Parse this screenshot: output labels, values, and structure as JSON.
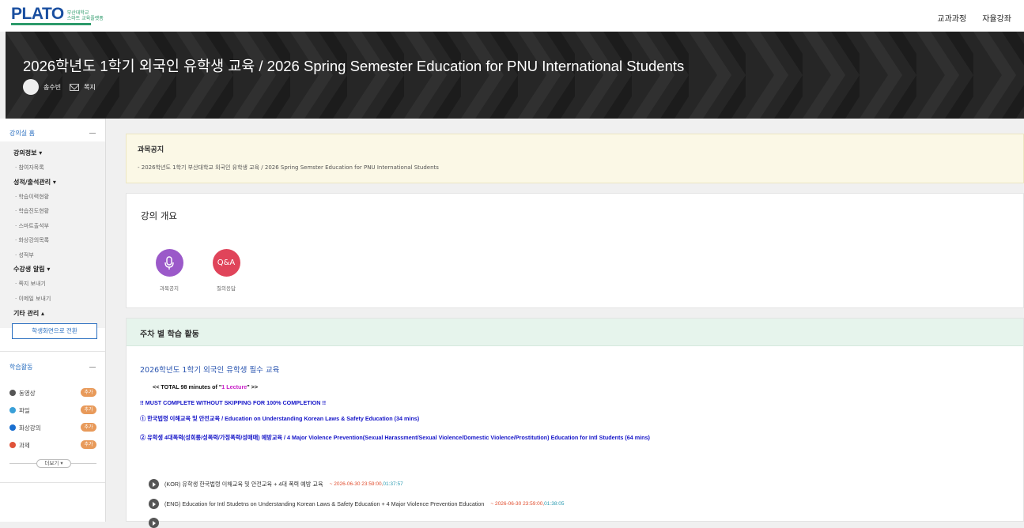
{
  "header": {
    "logo": "PLATO",
    "logo_sub1": "부산대학교",
    "logo_sub2": "스마트 교육플랫폼",
    "nav": [
      "교과과정",
      "자율강좌"
    ]
  },
  "banner": {
    "course_title": "2026학년도 1학기 외국인 유학생 교육 / 2026 Spring Semester Education for PNU International Students",
    "professor": "송수빈",
    "message_label": "쪽지"
  },
  "sidebar": {
    "home_label": "강의실 홈",
    "sections": [
      {
        "title": "강의정보 ▾",
        "items": [
          "· 참여자목록"
        ]
      },
      {
        "title": "성적/출석관리 ▾",
        "items": [
          "· 학습이력현황",
          "· 학습진도현황",
          "· 스마트출석부",
          "· 화상강의목록",
          "· 성적부"
        ]
      },
      {
        "title": "수강생 알림 ▾",
        "items": [
          "· 쪽지 보내기",
          "· 이메일 보내기"
        ]
      },
      {
        "title": "기타 관리 ▴",
        "items": []
      }
    ],
    "switch_button": "학생화면으로 전환",
    "activity_label": "학습활동",
    "activities": [
      {
        "label": "동영상",
        "badge": "추가",
        "color": "#555555"
      },
      {
        "label": "파일",
        "badge": "추가",
        "color": "#3aa0d8"
      },
      {
        "label": "화상강의",
        "badge": "추가",
        "color": "#1a6fd0"
      },
      {
        "label": "과제",
        "badge": "추가",
        "color": "#e0533a"
      }
    ],
    "more_button": "더보기 ▾"
  },
  "notice": {
    "title": "과목공지",
    "text": "- 2026학년도 1학기 부산대학교 외국인 유학생 교육 / 2026 Spring Semster Education for PNU International Students"
  },
  "overview": {
    "title": "강의 개요",
    "items": [
      {
        "label": "과목공지",
        "icon": "microphone-icon",
        "color": "#9b59c9"
      },
      {
        "label": "질의응답",
        "icon_text": "Q&A",
        "color": "#e0445a"
      }
    ]
  },
  "weekly": {
    "title": "주차 별 학습 활동",
    "section_title": "2026학년도 1학기 외국인 유학생 필수 교육",
    "total_prefix": "<< TOTAL 98 minutes of \"",
    "total_highlight": "1 Lecture",
    "total_suffix": "\" >>",
    "must_complete": "!! MUST COMPLETE WITHOUT SKIPPING FOR 100% COMPLETION !!",
    "line1": "① 한국법령 이해교육 및 안전교육 / Education on Understanding Korean Laws & Safety Education (34 mins)",
    "line2": "② 유학생 4대폭력(성희롱/성폭력/가정폭력/성매매) 예방교육 / 4 Major Violence Prevention(Sexual Harassment/Sexual Violence/Domestic Violence/Prostitution) Education for Intl Students (64 mins)",
    "videos": [
      {
        "title": "(KOR) 유학생 한국법령 이해교육 및 안전교육 + 4대 폭력 예방 교육",
        "deadline": "~ 2026-06-30 23:59:00, ",
        "duration": "01:37:57"
      },
      {
        "title": "(ENG) Education for Intl Studetns on Understanding Korean Laws & Safety Education + 4 Major Violence Prevention Education",
        "deadline": "~ 2026-06-30 23:59:00, ",
        "duration": "01:38:05"
      }
    ]
  }
}
